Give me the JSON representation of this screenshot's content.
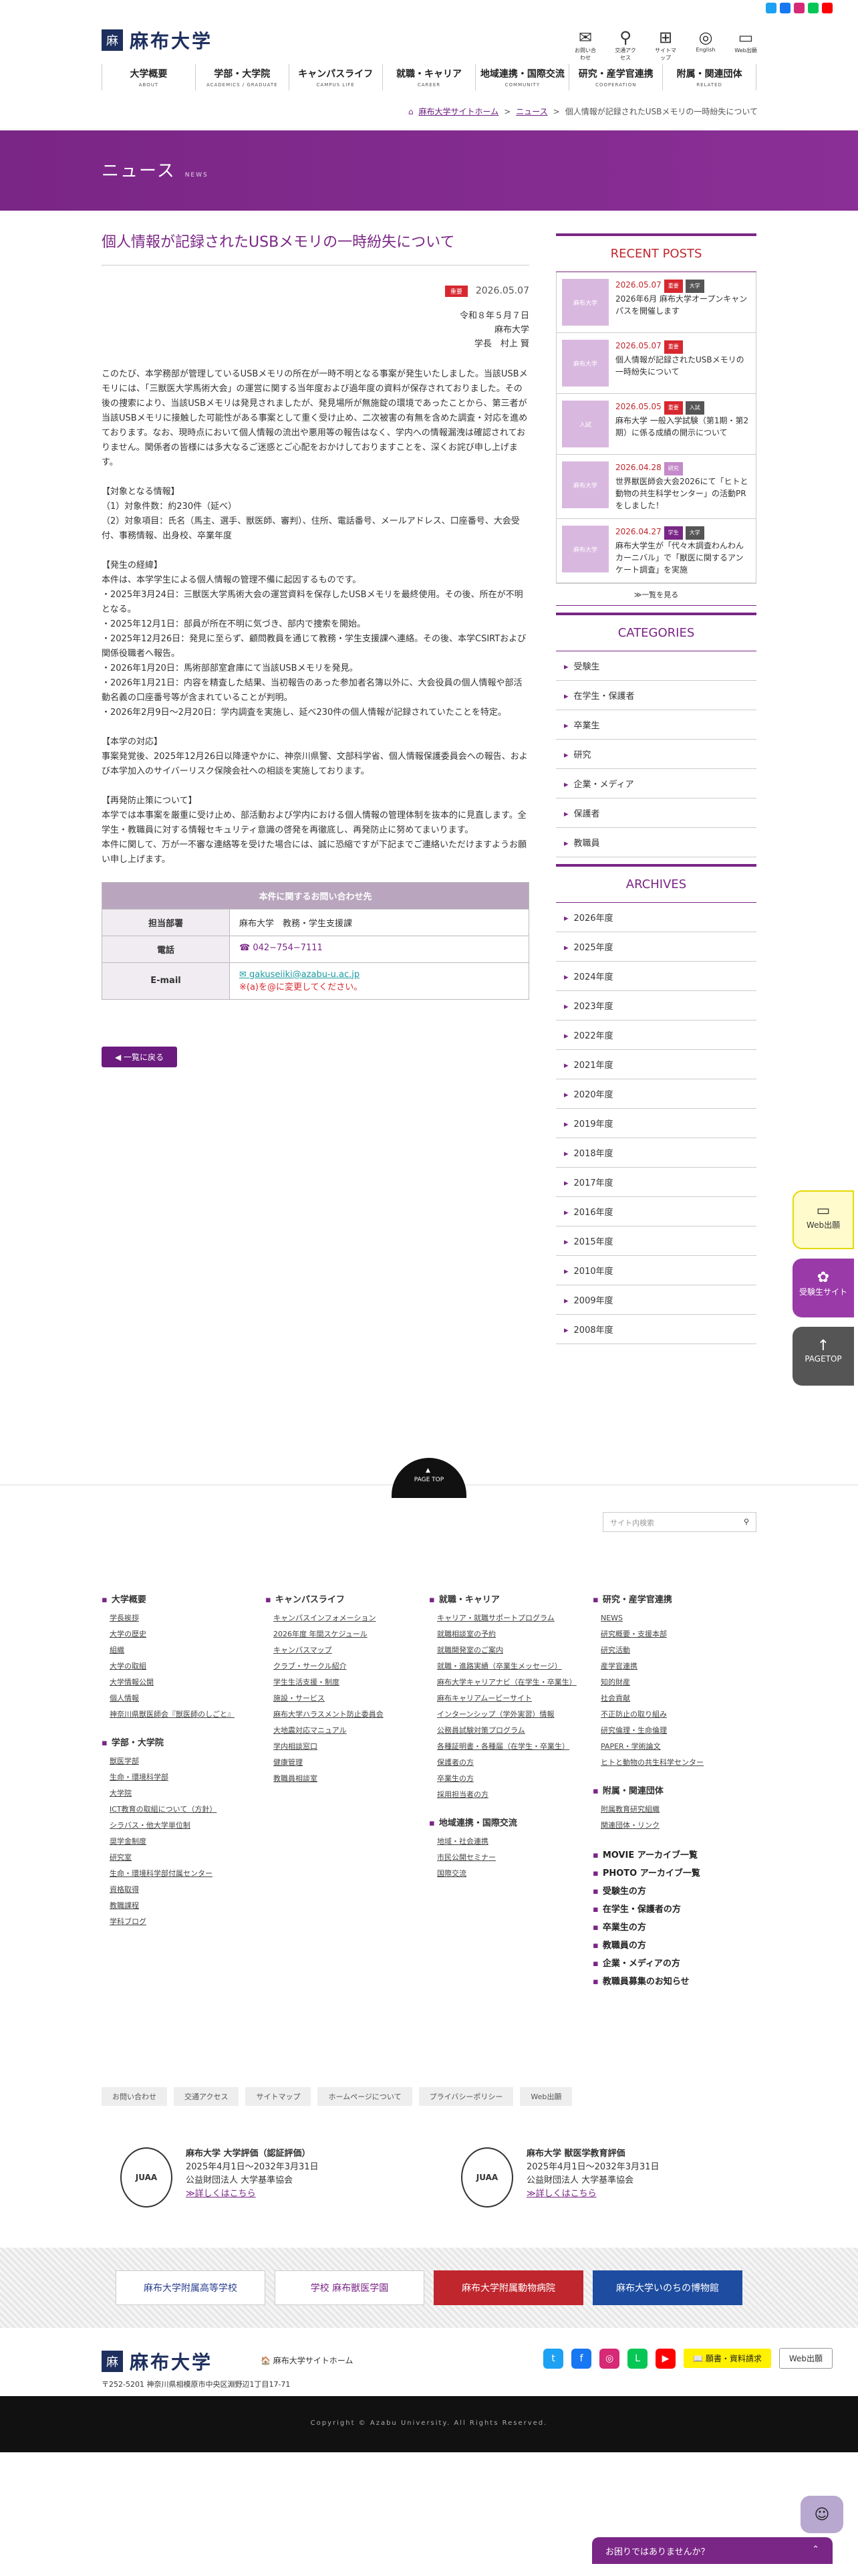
{
  "header": {
    "logo_text": "麻布大学",
    "utils": [
      {
        "icon": "✉",
        "label": "お問い合わせ"
      },
      {
        "icon": "⚲",
        "label": "交通アクセス"
      },
      {
        "icon": "⊞",
        "label": "サイトマップ"
      },
      {
        "icon": "◎",
        "label": "English"
      },
      {
        "icon": "▭",
        "label": "Web出願"
      }
    ],
    "nav": [
      {
        "ja": "大学概要",
        "en": "ABOUT"
      },
      {
        "ja": "学部・大学院",
        "en": "ACADEMICS / GRADUATE"
      },
      {
        "ja": "キャンパスライフ",
        "en": "CAMPUS LIFE"
      },
      {
        "ja": "就職・キャリア",
        "en": "CAREER"
      },
      {
        "ja": "地域連携・国際交流",
        "en": "COMMUNITY"
      },
      {
        "ja": "研究・産学官連携",
        "en": "COOPERATION"
      },
      {
        "ja": "附属・関連団体",
        "en": "RELATED"
      }
    ],
    "breadcrumb": {
      "home": "麻布大学サイトホーム",
      "sep": ">",
      "news": "ニュース",
      "current": "個人情報が記録されたUSBメモリの一時紛失について"
    }
  },
  "hero": {
    "title": "ニュース",
    "sub": "NEWS"
  },
  "article": {
    "title": "個人情報が記録されたUSBメモリの一時紛失について",
    "tag": "重要",
    "date": "2026.05.07",
    "sign": [
      "令和８年５月７日",
      "麻布大学",
      "学長　村上 賢"
    ],
    "paragraphs": [
      "このたび、本学務部が管理しているUSBメモリの所在が一時不明となる事案が発生いたしました。当該USBメモリには、「三獣医大学馬術大会」の運営に関する当年度および過年度の資料が保存されておりました。その後の捜索により、当該USBメモリは発見されましたが、発見場所が無施錠の環境であったことから、第三者が当該USBメモリに接触した可能性がある事案として重く受け止め、二次被害の有無を含めた調査・対応を進めております。なお、現時点において個人情報の流出や悪用等の報告はなく、学内への情報漏洩は確認されておりません。関係者の皆様には多大なるご迷惑とご心配をおかけしておりますことを、深くお詫び申し上げます。",
      "【対象となる情報】\n（1）対象件数：約230件（延べ）\n（2）対象項目：氏名（馬主、選手、獣医師、審判）、住所、電話番号、メールアドレス、口座番号、大会受付、事務情報、出身校、卒業年度",
      "【発生の経緯】\n本件は、本学学生による個人情報の管理不備に起因するものです。\n・2025年3月24日：三獣医大学馬術大会の運営資料を保存したUSBメモリを最終使用。その後、所在が不明となる。\n・2025年12月1日：部員が所在不明に気づき、部内で捜索を開始。\n・2025年12月26日：発見に至らず、顧問教員を通じて教務・学生支援課へ連絡。その後、本学CSIRTおよび関係役職者へ報告。\n・2026年1月20日：馬術部部室倉庫にて当該USBメモリを発見。\n・2026年1月21日：内容を精査した結果、当初報告のあった参加者名簿以外に、大会役員の個人情報や部活動名義の口座番号等が含まれていることが判明。\n・2026年2月9日〜2月20日：学内調査を実施し、延べ230件の個人情報が記録されていたことを特定。",
      "【本学の対応】\n事案発覚後、2025年12月26日以降速やかに、神奈川県警、文部科学省、個人情報保護委員会への報告、および本学加入のサイバーリスク保険会社への相談を実施しております。",
      "【再発防止策について】\n本学では本事案を厳重に受け止め、部活動および学内における個人情報の管理体制を抜本的に見直します。全学生・教職員に対する情報セキュリティ意識の啓発を再徹底し、再発防止に努めてまいります。\n本件に関して、万が一不審な連絡等を受けた場合には、誠に恐縮ですが下記までご連絡いただけますようお願い申し上げます。"
    ],
    "contact": {
      "header": "本件に関するお問い合わせ先",
      "dept_label": "担当部署",
      "dept": "麻布大学　教務・学生支援課",
      "tel_label": "電話",
      "tel": "☎ 042−754−7111",
      "mail_label": "E-mail",
      "mail": "✉ gakuseiiki@azabu-u.ac.jp",
      "mail_note": "※(a)を@に変更してください。"
    },
    "back": "◀ 一覧に戻る"
  },
  "sidebar": {
    "recent_title": "RECENT POSTS",
    "posts": [
      {
        "thumb": "麻布大学",
        "date": "2026.05.07",
        "tags": [
          "重要",
          "大学"
        ],
        "title": "2026年6月 麻布大学オープンキャンパスを開催します"
      },
      {
        "thumb": "麻布大学",
        "date": "2026.05.07",
        "tags": [
          "重要"
        ],
        "title": "個人情報が記録されたUSBメモリの一時紛失について"
      },
      {
        "thumb": "入試",
        "date": "2026.05.05",
        "tags": [
          "重要",
          "入試"
        ],
        "title": "麻布大学 一般入学試験（第1期・第2期）に係る成績の開示について"
      },
      {
        "thumb": "麻布大学",
        "date": "2026.04.28",
        "tags": [
          "研究"
        ],
        "title": "世界獣医師会大会2026にて「ヒトと動物の共生科学センター」の活動PRをしました！"
      },
      {
        "thumb": "麻布大学",
        "date": "2026.04.27",
        "tags": [
          "学生",
          "大学"
        ],
        "title": "麻布大学生が「代々木調査わんわんカーニバル」で「獣医に関するアンケート調査」を実施"
      }
    ],
    "more": "≫一覧を見る",
    "cat_title": "CATEGORIES",
    "categories": [
      "受験生",
      "在学生・保護者",
      "卒業生",
      "研究",
      "企業・メディア",
      "保護者",
      "教職員"
    ],
    "arc_title": "ARCHIVES",
    "archives": [
      "2026年度",
      "2025年度",
      "2024年度",
      "2023年度",
      "2022年度",
      "2021年度",
      "2020年度",
      "2019年度",
      "2018年度",
      "2017年度",
      "2016年度",
      "2015年度",
      "2010年度",
      "2009年度",
      "2008年度"
    ]
  },
  "float": {
    "web": "Web出願",
    "exam": "受験生サイト",
    "top": "PAGETOP"
  },
  "footer": {
    "pagetop": "PAGE TOP",
    "search_placeholder": "サイト内検索",
    "col1": {
      "h1": "大学概要",
      "items1": [
        "学長挨拶",
        "大学の歴史",
        "組織",
        "大学の取組",
        "大学情報公開",
        "個人情報",
        "神奈川県獣医師会『獣医師のしごと』"
      ],
      "h2": "学部・大学院",
      "items2": [
        "獣医学部",
        "生命・環境科学部",
        "大学院",
        "ICT教育の取組について（方針）",
        "シラバス・他大学単位制",
        "奨学金制度",
        "研究室",
        "生命・環境科学部付属センター",
        "資格取得",
        "教職課程",
        "学科ブログ"
      ]
    },
    "col2": {
      "h1": "キャンパスライフ",
      "items1": [
        "キャンパスインフォメーション",
        "2026年度 年間スケジュール",
        "キャンパスマップ",
        "クラブ・サークル紹介",
        "学生生活支援・制度",
        "施設・サービス",
        "麻布大学ハラスメント防止委員会",
        "大地震対応マニュアル",
        "学内相談窓口",
        "健康管理",
        "教職員相談室"
      ]
    },
    "col3": {
      "h1": "就職・キャリア",
      "items1": [
        "キャリア・就職サポートプログラム",
        "就職相談室の予約",
        "就職開発室のご案内",
        "就職・進路実績（卒業生メッセージ）",
        "麻布大学キャリアナビ（在学生・卒業生）",
        "麻布キャリアムービーサイト",
        "インターンシップ（学外実習）情報",
        "公務員試験対策プログラム",
        "各種証明書・各種届（在学生・卒業生）",
        "保護者の方",
        "卒業生の方",
        "採用担当者の方"
      ],
      "h2": "地域連携・国際交流",
      "items2": [
        "地域・社会連携",
        "市民公開セミナー",
        "国際交流"
      ]
    },
    "col4": {
      "h1": "研究・産学官連携",
      "items1": [
        "NEWS",
        "研究概要・支援本部",
        "研究活動",
        "産学官連携",
        "知的財産",
        "社会貢献",
        "不正防止の取り組み",
        "研究倫理・生命倫理",
        "PAPER・学術論文",
        "ヒトと動物の共生科学センター"
      ],
      "h2": "附属・関連団体",
      "items2": [
        "附属教育研究組織",
        "関連団体・リンク"
      ],
      "bigs": [
        "MOVIE アーカイブ一覧",
        "PHOTO アーカイブ一覧",
        "受験生の方",
        "在学生・保護者の方",
        "卒業生の方",
        "教職員の方",
        "企業・メディアの方",
        "教職員募集のお知らせ"
      ]
    },
    "buttons": [
      "お問い合わせ",
      "交通アクセス",
      "サイトマップ",
      "ホームページについて",
      "プライバシーポリシー",
      "Web出願"
    ],
    "eval1": {
      "title": "麻布大学 大学評価（認証評価）",
      "period": "2025年4月1日〜2032年3月31日",
      "org": "公益財団法人 大学基準協会",
      "link": "≫詳しくはこちら"
    },
    "eval2": {
      "title": "麻布大学 獣医学教育評価",
      "period": "2025年4月1日〜2032年3月31日",
      "org": "公益財団法人 大学基準協会",
      "link": "≫詳しくはこちら"
    },
    "banners": [
      "麻布大学附属高等学校",
      "学校 麻布獣医学園",
      "麻布大学附属動物病院",
      "麻布大学いのちの博物館"
    ],
    "logo_text": "麻布大学",
    "site_home": "🏠 麻布大学サイトホーム",
    "address": "〒252-5201 神奈川県相模原市中央区淵野辺1丁目17-71",
    "req": "📖 願書・資料請求",
    "webapp": "Web出願",
    "copyright": "Copyright © Azabu University. All Rights Reserved."
  },
  "chat": "お困りではありませんか？"
}
